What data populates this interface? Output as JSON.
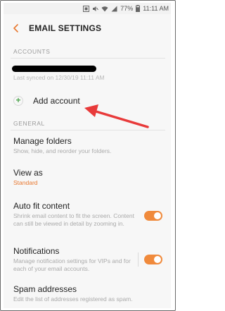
{
  "status_bar": {
    "battery": "77%",
    "time": "11:11 AM",
    "icons": [
      "screenshot-icon",
      "mute-icon",
      "wifi-icon",
      "signal-icon",
      "battery-icon"
    ]
  },
  "header": {
    "title": "EMAIL SETTINGS",
    "back_icon": "back-arrow-icon"
  },
  "accounts": {
    "section_label": "ACCOUNTS",
    "synced_text": "Last synced on 12/30/19  11:11 AM",
    "add_label": "Add account"
  },
  "general": {
    "section_label": "GENERAL",
    "manage_folders": {
      "title": "Manage folders",
      "subtitle": "Show, hide, and reorder your folders."
    },
    "view_as": {
      "title": "View as",
      "value": "Standard"
    },
    "auto_fit": {
      "title": "Auto fit content",
      "subtitle": "Shrink email content to fit the screen. Content can still be viewed in detail by zooming in.",
      "enabled": true
    },
    "notifications": {
      "title": "Notifications",
      "subtitle": "Manage notification settings for VIPs and for each of your email accounts.",
      "enabled": true
    },
    "spam": {
      "title": "Spam addresses",
      "subtitle": "Edit the list of addresses registered as spam."
    }
  },
  "colors": {
    "accent": "#f08a3c",
    "annotation_arrow": "#e83a3a"
  }
}
